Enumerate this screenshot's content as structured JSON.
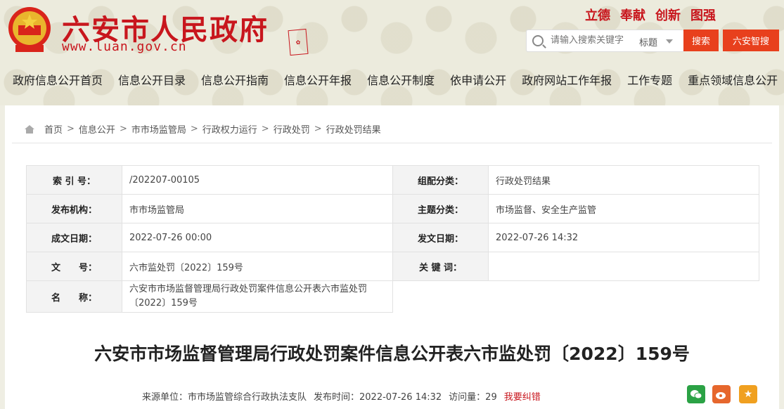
{
  "header": {
    "site_title": "六安市人民政府",
    "site_url": "www.luan.gov.cn",
    "slogans": [
      "立德",
      "奉献",
      "创新",
      "图强"
    ],
    "search": {
      "placeholder": "请输入搜索关键字",
      "scope": "标题",
      "button": "搜索",
      "smart_button": "六安智搜"
    }
  },
  "nav": [
    "政府信息公开首页",
    "信息公开目录",
    "信息公开指南",
    "信息公开年报",
    "信息公开制度",
    "依申请公开",
    "政府网站工作年报",
    "工作专题",
    "重点领域信息公开"
  ],
  "breadcrumb": [
    "首页",
    "信息公开",
    "市市场监管局",
    "行政权力运行",
    "行政处罚",
    "行政处罚结果"
  ],
  "meta": {
    "index_label": "索 引 号：",
    "index_value": "/202207-00105",
    "group_label": "组配分类：",
    "group_value": "行政处罚结果",
    "publisher_label": "发布机构：",
    "publisher_value": "市市场监管局",
    "topic_label": "主题分类：",
    "topic_value": "市场监督、安全生产监管",
    "created_label": "成文日期：",
    "created_value": "2022-07-26 00:00",
    "issued_label": "发文日期：",
    "issued_value": "2022-07-26 14:32",
    "docno_label": "文　　号：",
    "docno_value": "六市监处罚〔2022〕159号",
    "keywords_label": "关 键 词：",
    "keywords_value": "",
    "name_label": "名　　称：",
    "name_value": "六安市市场监督管理局行政处罚案件信息公开表六市监处罚〔2022〕159号"
  },
  "doc_title": "六安市市场监督管理局行政处罚案件信息公开表六市监处罚〔2022〕159号",
  "source": {
    "unit": "来源单位：市市场监管综合行政执法支队",
    "time": "发布时间：2022-07-26 14:32",
    "views": "访问量：29",
    "report_error": "我要纠错"
  },
  "colors": {
    "brand_red": "#c8161d",
    "button_orange": "#e8401d",
    "wechat": "#2ba245",
    "weibo": "#e6672d",
    "favorite": "#f0a020"
  }
}
